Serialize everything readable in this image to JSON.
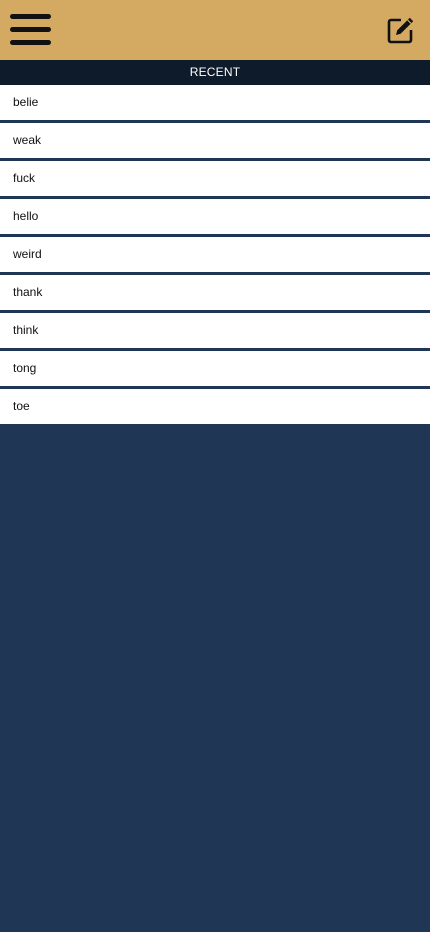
{
  "header": {
    "menu_icon": "hamburger-menu-icon",
    "edit_icon": "edit-note-icon",
    "background": "#d4aa63"
  },
  "section": {
    "title": "RECENT"
  },
  "recent": [
    {
      "label": "belie"
    },
    {
      "label": "weak"
    },
    {
      "label": "fuck"
    },
    {
      "label": "hello"
    },
    {
      "label": "weird"
    },
    {
      "label": "thank"
    },
    {
      "label": "think"
    },
    {
      "label": "tong"
    },
    {
      "label": "toe"
    }
  ],
  "colors": {
    "accent": "#d4aa63",
    "header_dark": "#0e1b2b",
    "background": "#1f3654"
  }
}
